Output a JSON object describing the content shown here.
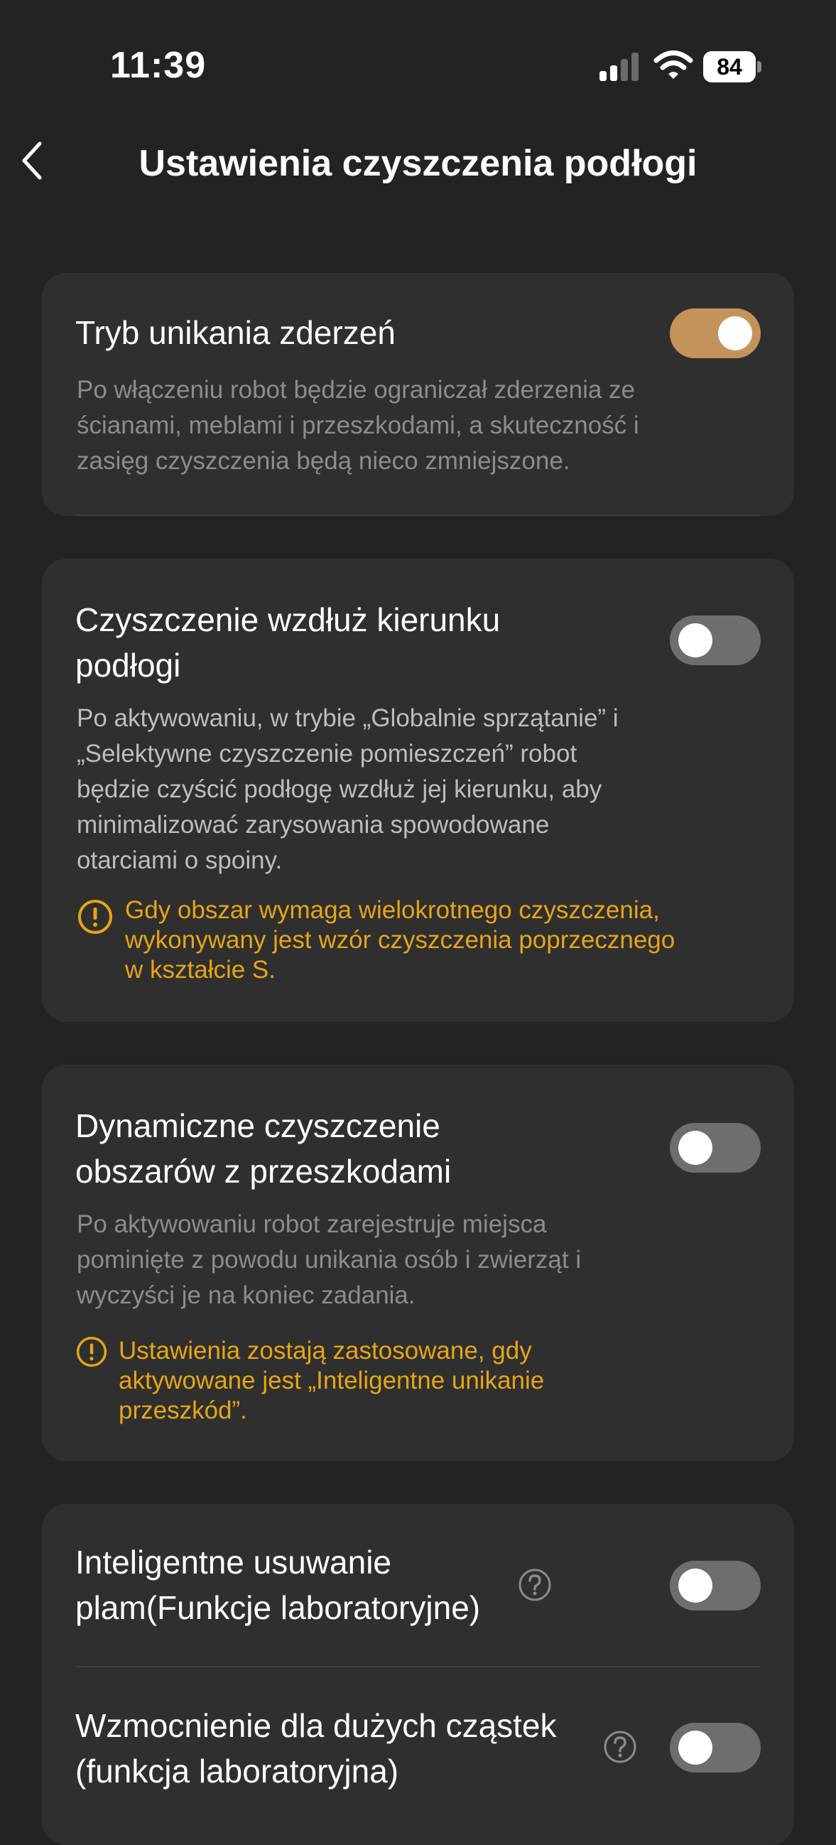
{
  "status_bar": {
    "time": "11:39",
    "battery": "84"
  },
  "header": {
    "title": "Ustawienia czyszczenia podłogi"
  },
  "settings": [
    {
      "title": "Tryb unikania zderzeń",
      "enabled": true,
      "description_lines": [
        "Po włączeniu robot będzie ograniczał zderzenia ze",
        "ścianami, meblami i przeszkodami, a skuteczność i",
        "zasięg czyszczenia będą nieco zmniejszone."
      ]
    },
    {
      "title_lines": [
        "Czyszczenie wzdłuż kierunku",
        "podłogi"
      ],
      "enabled": false,
      "description_lines": [
        "Po aktywowaniu, w trybie „Globalnie sprzątanie” i",
        "„Selektywne czyszczenie pomieszczeń” robot",
        "będzie czyścić podłogę wzdłuż jej kierunku, aby",
        "minimalizować zarysowania spowodowane",
        "otarciami o spoiny."
      ],
      "warning_lines": [
        "Gdy obszar wymaga wielokrotnego czyszczenia,",
        "wykonywany jest wzór czyszczenia poprzecznego",
        "w kształcie S."
      ]
    },
    {
      "title_lines": [
        "Dynamiczne czyszczenie",
        "obszarów z przeszkodami"
      ],
      "enabled": false,
      "description_lines": [
        "Po aktywowaniu robot zarejestruje miejsca",
        "pominięte z powodu unikania osób i zwierząt i",
        "wyczyści je na koniec zadania."
      ],
      "warning_lines": [
        "Ustawienia zostają zastosowane, gdy",
        "aktywowane jest „Inteligentne unikanie",
        "przeszkód”."
      ]
    },
    {
      "title_lines": [
        "Inteligentne usuwanie",
        "plam(Funkcje laboratoryjne)"
      ],
      "enabled": false
    },
    {
      "title_lines": [
        "Wzmocnienie dla dużych cząstek",
        "(funkcja laboratoryjna)"
      ],
      "enabled": false
    }
  ],
  "colors": {
    "accent": "#c4935c",
    "warning": "#e6a516",
    "background": "#232323",
    "card": "#2f2f2f"
  }
}
